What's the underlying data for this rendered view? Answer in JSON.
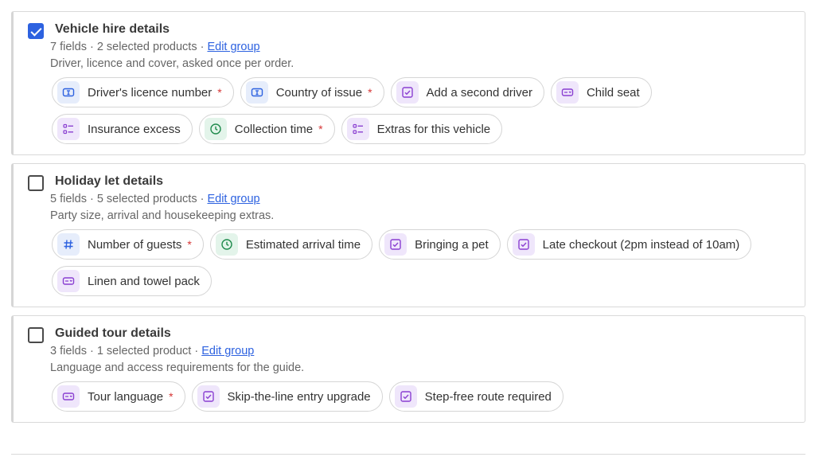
{
  "groups": [
    {
      "title": "Vehicle hire details",
      "checked": true,
      "meta_text": "7 fields · 2 selected products · ",
      "edit_label": "Edit group",
      "description": "Driver, licence and cover, asked once per order.",
      "fields": [
        {
          "label": "Driver's licence number",
          "icon": "text-field-icon",
          "color": "blue",
          "required": true
        },
        {
          "label": "Country of issue",
          "icon": "text-field-icon",
          "color": "blue",
          "required": true
        },
        {
          "label": "Add a second driver",
          "icon": "checkbox-icon",
          "color": "purple",
          "required": false
        },
        {
          "label": "Child seat",
          "icon": "dropdown-icon",
          "color": "purple",
          "required": false
        },
        {
          "label": "Insurance excess",
          "icon": "list-options-icon",
          "color": "purple",
          "required": false
        },
        {
          "label": "Collection time",
          "icon": "clock-icon",
          "color": "green",
          "required": true
        },
        {
          "label": "Extras for this vehicle",
          "icon": "list-options-icon",
          "color": "purple",
          "required": false
        }
      ]
    },
    {
      "title": "Holiday let details",
      "checked": false,
      "meta_text": "5 fields · 5 selected products · ",
      "edit_label": "Edit group",
      "description": "Party size, arrival and housekeeping extras.",
      "fields": [
        {
          "label": "Number of guests",
          "icon": "hash-icon",
          "color": "blue",
          "required": true
        },
        {
          "label": "Estimated arrival time",
          "icon": "clock-icon",
          "color": "green",
          "required": false
        },
        {
          "label": "Bringing a pet",
          "icon": "checkbox-icon",
          "color": "purple",
          "required": false
        },
        {
          "label": "Late checkout (2pm instead of 10am)",
          "icon": "checkbox-icon",
          "color": "purple",
          "required": false
        },
        {
          "label": "Linen and towel pack",
          "icon": "dropdown-icon",
          "color": "purple",
          "required": false
        }
      ]
    },
    {
      "title": "Guided tour details",
      "checked": false,
      "meta_text": "3 fields · 1 selected product · ",
      "edit_label": "Edit group",
      "description": "Language and access requirements for the guide.",
      "fields": [
        {
          "label": "Tour language",
          "icon": "dropdown-icon",
          "color": "purple",
          "required": true
        },
        {
          "label": "Skip-the-line entry upgrade",
          "icon": "checkbox-icon",
          "color": "purple",
          "required": false
        },
        {
          "label": "Step-free route required",
          "icon": "checkbox-icon",
          "color": "purple",
          "required": false
        }
      ]
    }
  ],
  "required_marker": "*",
  "colors": {
    "accent": "#2d62e0",
    "required": "#d63636",
    "blue_icon": "#2d62e0",
    "purple_icon": "#8a3fd1",
    "green_icon": "#1f8a4c"
  }
}
